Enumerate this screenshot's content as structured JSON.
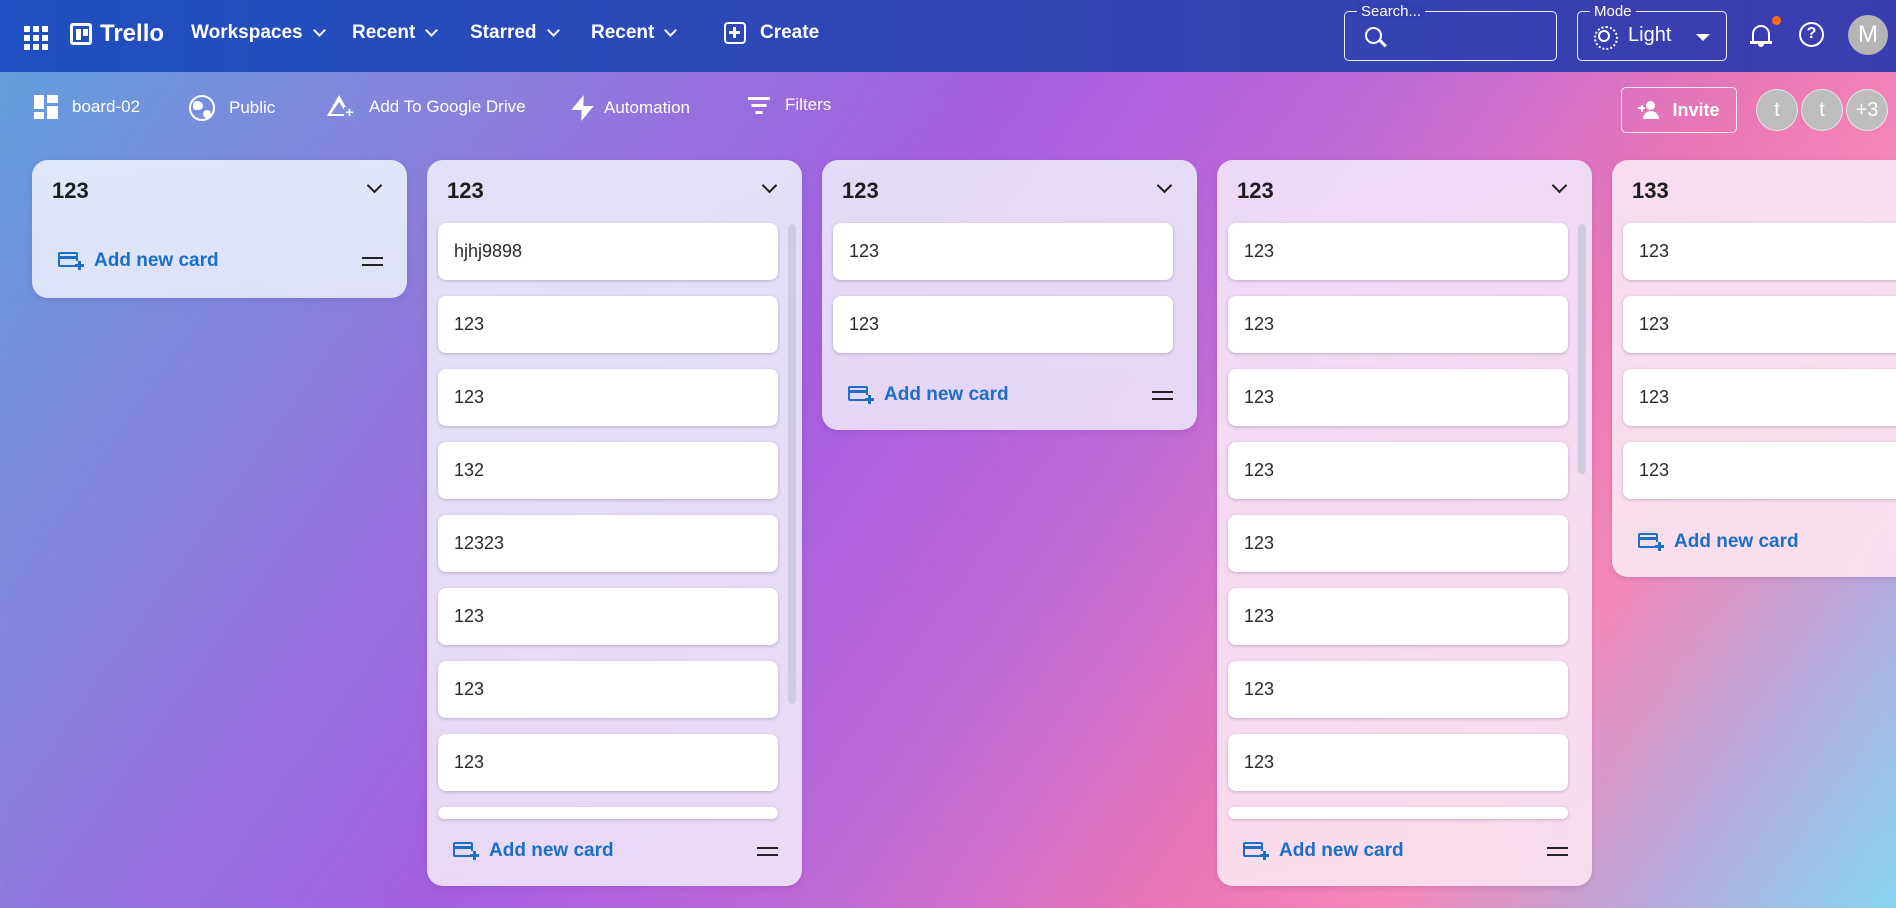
{
  "appbar": {
    "app_name": "Trello",
    "nav": [
      "Workspaces",
      "Recent",
      "Starred",
      "Recent"
    ],
    "create_label": "Create",
    "search_label": "Search...",
    "search_placeholder": "",
    "mode_label": "Mode",
    "mode_value": "Light",
    "avatar_initial": "M",
    "help_glyph": "?"
  },
  "boardbar": {
    "board_name": "board-02",
    "visibility": "Public",
    "drive_label": "Add To Google Drive",
    "automation_label": "Automation",
    "filters_label": "Filters",
    "invite_label": "Invite",
    "members": [
      "t",
      "t"
    ],
    "more_members": "+3"
  },
  "add_card_label": "Add new card",
  "columns": [
    {
      "title": "123",
      "cards": []
    },
    {
      "title": "123",
      "cards": [
        "hjhj9898",
        "123",
        "123",
        "132",
        "12323",
        "123",
        "123",
        "123"
      ]
    },
    {
      "title": "123",
      "cards": [
        "123",
        "123"
      ]
    },
    {
      "title": "123",
      "cards": [
        "123",
        "123",
        "123",
        "123",
        "123",
        "123",
        "123",
        "123"
      ]
    },
    {
      "title": "133",
      "cards": [
        "123",
        "123",
        "123",
        "123"
      ]
    }
  ],
  "colors": {
    "accent_blue": "#1b6fc7",
    "appbar_start": "#1f4fc0",
    "appbar_end": "#3a3db0",
    "notification_dot": "#ff6a1a"
  }
}
